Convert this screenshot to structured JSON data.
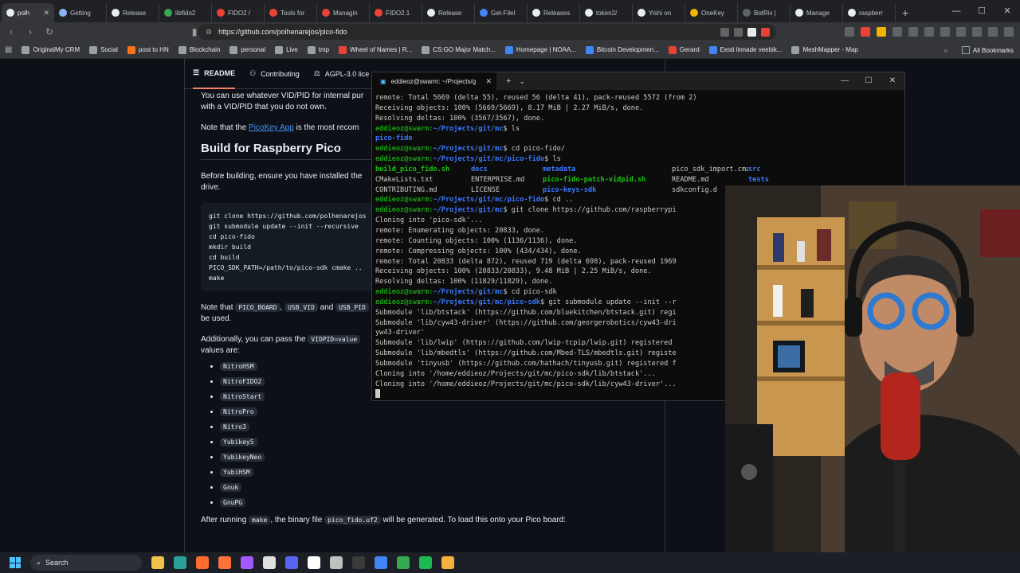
{
  "browser": {
    "tabs": [
      {
        "title": "polh",
        "color": "#e6edf3",
        "active": true
      },
      {
        "title": "Getting",
        "color": "#8ab4f8"
      },
      {
        "title": "Release",
        "color": "#e6edf3"
      },
      {
        "title": "libfido2",
        "color": "#34a853"
      },
      {
        "title": "FIDO2 /",
        "color": "#ea4335"
      },
      {
        "title": "Tools for",
        "color": "#ea4335"
      },
      {
        "title": "Managin",
        "color": "#ea4335"
      },
      {
        "title": "FIDO2.1",
        "color": "#ea4335"
      },
      {
        "title": "Release",
        "color": "#e6edf3"
      },
      {
        "title": "Get-FileI",
        "color": "#4285f4"
      },
      {
        "title": "Releases",
        "color": "#e6edf3"
      },
      {
        "title": "token2/",
        "color": "#e6edf3"
      },
      {
        "title": "Yishi on",
        "color": "#e6edf3"
      },
      {
        "title": "OneKey",
        "color": "#f4b400"
      },
      {
        "title": "BotRix |",
        "color": "#5f6368"
      },
      {
        "title": "Manage",
        "color": "#e6edf3"
      },
      {
        "title": "raspberr",
        "color": "#e6edf3"
      }
    ],
    "url": "https://github.com/polhenarejos/pico-fido",
    "bookmarks": [
      {
        "label": "OriginalMy CRM",
        "color": "#9aa0a6"
      },
      {
        "label": "Social",
        "color": "#9aa0a6"
      },
      {
        "label": "post to HN",
        "color": "#f97316"
      },
      {
        "label": "Blockchain",
        "color": "#9aa0a6"
      },
      {
        "label": "personal",
        "color": "#9aa0a6"
      },
      {
        "label": "Live",
        "color": "#9aa0a6"
      },
      {
        "label": "tmp",
        "color": "#9aa0a6"
      },
      {
        "label": "Wheel of Names | R...",
        "color": "#ea4335"
      },
      {
        "label": "CS:GO Major Match...",
        "color": "#9aa0a6"
      },
      {
        "label": "Homepage | NOAA...",
        "color": "#4285f4"
      },
      {
        "label": "Bitcoin Developmen...",
        "color": "#4285f4"
      },
      {
        "label": "Gerard",
        "color": "#ea4335"
      },
      {
        "label": "Eesti linnade veebik...",
        "color": "#4285f4"
      },
      {
        "label": "MeshMapper - Map",
        "color": "#9aa0a6"
      }
    ],
    "all_bookmarks": "All Bookmarks"
  },
  "github": {
    "tabs": [
      "README",
      "Contributing",
      "AGPL-3.0 lice"
    ],
    "para1": "You can use whatever VID/PID for internal pur",
    "para1b": "with a VID/PID that you do not own.",
    "para2_a": "Note that the ",
    "para2_link": "PicoKey App",
    "para2_b": " is the most recom",
    "heading": "Build for Raspberry Pico",
    "para3": "Before building, ensure you have installed the",
    "para3b": "drive.",
    "code": [
      "git clone https://github.com/polhenarejos",
      "git submodule update --init --recursive",
      "cd pico-fido",
      "mkdir build",
      "cd build",
      "PICO_SDK_PATH=/path/to/pico-sdk cmake ..",
      "make"
    ],
    "para4_a": "Note that ",
    "para4_c1": "PICO_BOARD",
    "para4_s1": ", ",
    "para4_c2": "USB_VID",
    "para4_s2": " and ",
    "para4_c3": "USB_PID",
    "para4_b": "be used.",
    "para5_a": "Additionally, you can pass the ",
    "para5_c": "VIDPID=value",
    "para5_b": "values are:",
    "vidpid_values": [
      "NitroHSM",
      "NitroFIDO2",
      "NitroStart",
      "NitroPro",
      "Nitro3",
      "Yubikey5",
      "YubikeyNeo",
      "YubiHSM",
      "Gnuk",
      "GnuPG"
    ],
    "para6_a": "After running ",
    "para6_c1": "make",
    "para6_b": ", the binary file ",
    "para6_c2": "pico_fido.uf2",
    "para6_d": " will be generated. To load this onto your Pico board:"
  },
  "terminal": {
    "tab_title": "eddieoz@swarm: ~/Projects/g",
    "lines": [
      {
        "t": "remote: Total 5669 (delta 55), reused 56 (delta 41), pack-reused 5572 (from 2)"
      },
      {
        "t": "Receiving objects: 100% (5669/5669), 8.17 MiB | 2.27 MiB/s, done."
      },
      {
        "t": "Resolving deltas: 100% (3567/3567), done."
      },
      {
        "p": "~/Projects/git/mc",
        "c": " ls"
      },
      {
        "blue": "pico-fido"
      },
      {
        "p": "~/Projects/git/mc",
        "c": " cd pico-fido/"
      },
      {
        "p": "~/Projects/git/mc/pico-fido",
        "c": " ls"
      },
      {
        "cols": [
          [
            "build_pico_fido.sh",
            "green"
          ],
          [
            "docs",
            "blue"
          ],
          [
            "metadata",
            "blue"
          ],
          [
            "",
            ""
          ],
          [
            "pico_sdk_import.cmake",
            ""
          ],
          [
            "src",
            "blue"
          ]
        ]
      },
      {
        "cols": [
          [
            "CMakeLists.txt",
            ""
          ],
          [
            "ENTERPRISE.md",
            ""
          ],
          [
            "pico-fido-patch-vidpid.sh",
            "green"
          ],
          [
            "",
            ""
          ],
          [
            "README.md",
            ""
          ],
          [
            "tests",
            "blue"
          ]
        ]
      },
      {
        "cols": [
          [
            "CONTRIBUTING.md",
            ""
          ],
          [
            "LICENSE",
            ""
          ],
          [
            "pico-keys-sdk",
            "blue"
          ],
          [
            "",
            ""
          ],
          [
            "sdkconfig.d",
            ""
          ],
          [
            "",
            ""
          ]
        ]
      },
      {
        "p": "~/Projects/git/mc/pico-fido",
        "c": " cd .."
      },
      {
        "p": "~/Projects/git/mc",
        "c": " git clone https://github.com/raspberrypi"
      },
      {
        "t": "Cloning into 'pico-sdk'..."
      },
      {
        "t": "remote: Enumerating objects: 20833, done."
      },
      {
        "t": "remote: Counting objects: 100% (1136/1136), done."
      },
      {
        "t": "remote: Compressing objects: 100% (434/434), done."
      },
      {
        "t": "remote: Total 20833 (delta 872), reused 719 (delta 698), pack-reused 1969"
      },
      {
        "t": "Receiving objects: 100% (20833/20833), 9.48 MiB | 2.25 MiB/s, done."
      },
      {
        "t": "Resolving deltas: 100% (11829/11829), done."
      },
      {
        "p": "~/Projects/git/mc",
        "c": " cd pico-sdk"
      },
      {
        "p": "~/Projects/git/mc/pico-sdk",
        "c": " git submodule update --init --r"
      },
      {
        "t": "Submodule 'lib/btstack' (https://github.com/bluekitchen/btstack.git) regi"
      },
      {
        "t": "Submodule 'lib/cyw43-driver' (https://github.com/georgerobotics/cyw43-dri"
      },
      {
        "t": "yw43-driver'"
      },
      {
        "t": "Submodule 'lib/lwip' (https://github.com/lwip-tcpip/lwip.git) registered"
      },
      {
        "t": "Submodule 'lib/mbedtls' (https://github.com/Mbed-TLS/mbedtls.git) registe"
      },
      {
        "t": "Submodule 'tinyusb' (https://github.com/hathach/tinyusb.git) registered f"
      },
      {
        "t": "Cloning into '/home/eddieoz/Projects/git/mc/pico-sdk/lib/btstack'..."
      },
      {
        "t": "Cloning into '/home/eddieoz/Projects/git/mc/pico-sdk/lib/cyw43-driver'..."
      },
      {
        "cursor": true
      }
    ],
    "prompt_user": "eddieoz@swarm:",
    "prompt_end": "$"
  },
  "taskbar": {
    "search": "Search",
    "apps": [
      "#f0c24b",
      "#2aa198",
      "#ff6b2b",
      "#ff7139",
      "#a259ff",
      "#e0e0e0",
      "#5865f2",
      "#ffffff",
      "#c0c0c0",
      "#3a3a3a",
      "#4285f4",
      "#34a853",
      "#1db954",
      "#f5b041"
    ]
  },
  "webcam": {
    "description_colors": {
      "wall": "#5a4a3c",
      "shelf": "#c79a56",
      "shirt": "#1f1f1f",
      "mic": "#c0392b"
    }
  }
}
